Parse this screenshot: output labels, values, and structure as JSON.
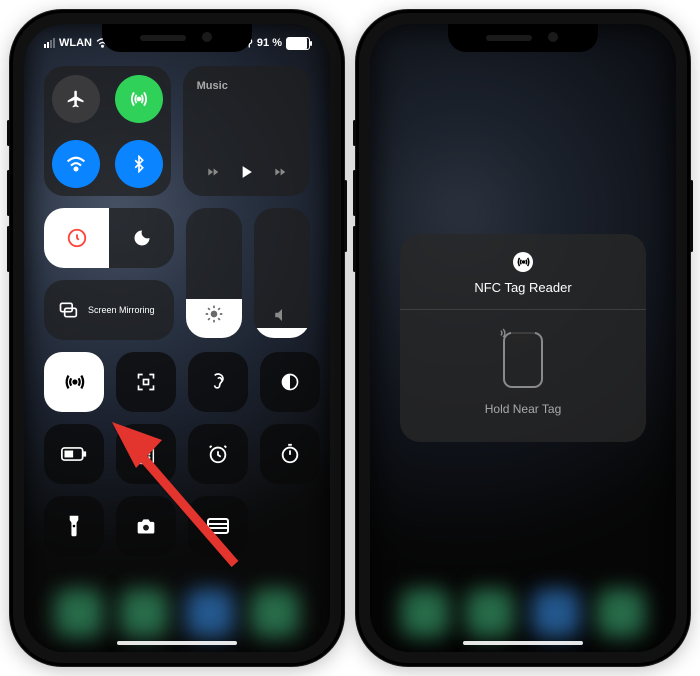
{
  "status": {
    "carrier": "WLAN",
    "battery_pct": "91 %"
  },
  "music": {
    "title": "Music"
  },
  "mirror": {
    "label": "Screen Mirroring"
  },
  "brightness_pct": 30,
  "volume_pct": 8,
  "highlighted_button": "nfc-tag-reader",
  "popup": {
    "title": "NFC Tag Reader",
    "hint": "Hold Near Tag"
  }
}
